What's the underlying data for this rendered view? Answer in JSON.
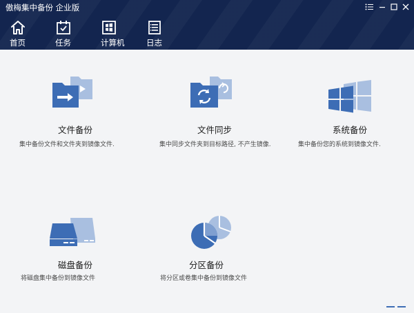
{
  "app": {
    "title": "傲梅集中备份 企业版"
  },
  "nav": [
    {
      "label": "首页",
      "icon": "home-icon"
    },
    {
      "label": "任务",
      "icon": "task-icon"
    },
    {
      "label": "计算机",
      "icon": "computer-icon"
    },
    {
      "label": "日志",
      "icon": "log-icon"
    }
  ],
  "cards": [
    {
      "title": "文件备份",
      "desc": "集中备份文件和文件夹到镜像文件.",
      "icon": "file-backup-icon"
    },
    {
      "title": "文件同步",
      "desc": "集中同步文件夹到目标路径, 不产生镜像.",
      "icon": "file-sync-icon"
    },
    {
      "title": "系统备份",
      "desc": "集中备份您的系统到镜像文件.",
      "icon": "system-backup-icon"
    },
    {
      "title": "磁盘备份",
      "desc": "将磁盘集中备份到镜像文件",
      "icon": "disk-backup-icon"
    },
    {
      "title": "分区备份",
      "desc": "将分区或卷集中备份到镜像文件",
      "icon": "partition-backup-icon"
    }
  ],
  "colors": {
    "header_bg": "#13254f",
    "icon_dark": "#3d6db5",
    "icon_light": "#a9bfe0",
    "icon_mid": "#7f9fd0",
    "footer_dash": "#3d6db5"
  }
}
